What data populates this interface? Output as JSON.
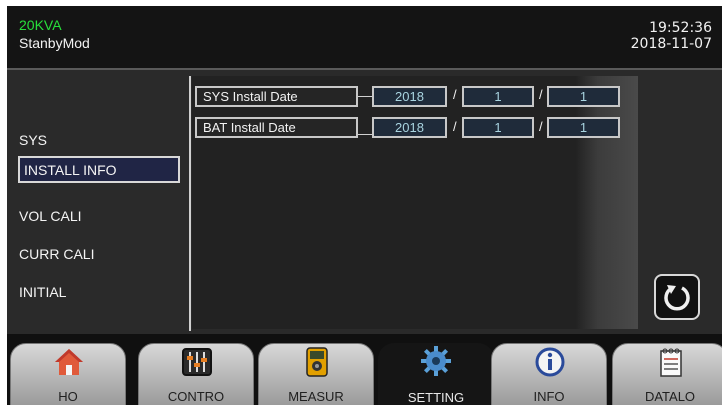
{
  "status": {
    "rating": "20KVA",
    "mode": "StanbyMod",
    "time": "19:52:36",
    "date": "2018-11-07"
  },
  "sidebar": {
    "items": [
      {
        "label": "SYS",
        "selected": false
      },
      {
        "label": "INSTALL INFO",
        "selected": true
      },
      {
        "label": "VOL CALI",
        "selected": false
      },
      {
        "label": "CURR CALI",
        "selected": false
      },
      {
        "label": "INITIAL",
        "selected": false
      }
    ]
  },
  "install": {
    "rows": [
      {
        "label": "SYS Install Date",
        "year": "2018",
        "month": "1",
        "day": "1"
      },
      {
        "label": "BAT Install Date",
        "year": "2018",
        "month": "1",
        "day": "1"
      }
    ],
    "separator": "/"
  },
  "nav": {
    "tabs": [
      {
        "label": "HO",
        "icon": "home-icon"
      },
      {
        "label": "CONTRO",
        "icon": "sliders-icon"
      },
      {
        "label": "MEASUR",
        "icon": "meter-icon"
      },
      {
        "label": "SETTING",
        "icon": "gear-icon",
        "active": true
      },
      {
        "label": "INFO",
        "icon": "info-icon"
      },
      {
        "label": "DATALO",
        "icon": "notepad-icon"
      }
    ]
  },
  "colors": {
    "rating": "#27e03a",
    "selected_bg": "#202545",
    "value_text": "#a9d4e0"
  }
}
